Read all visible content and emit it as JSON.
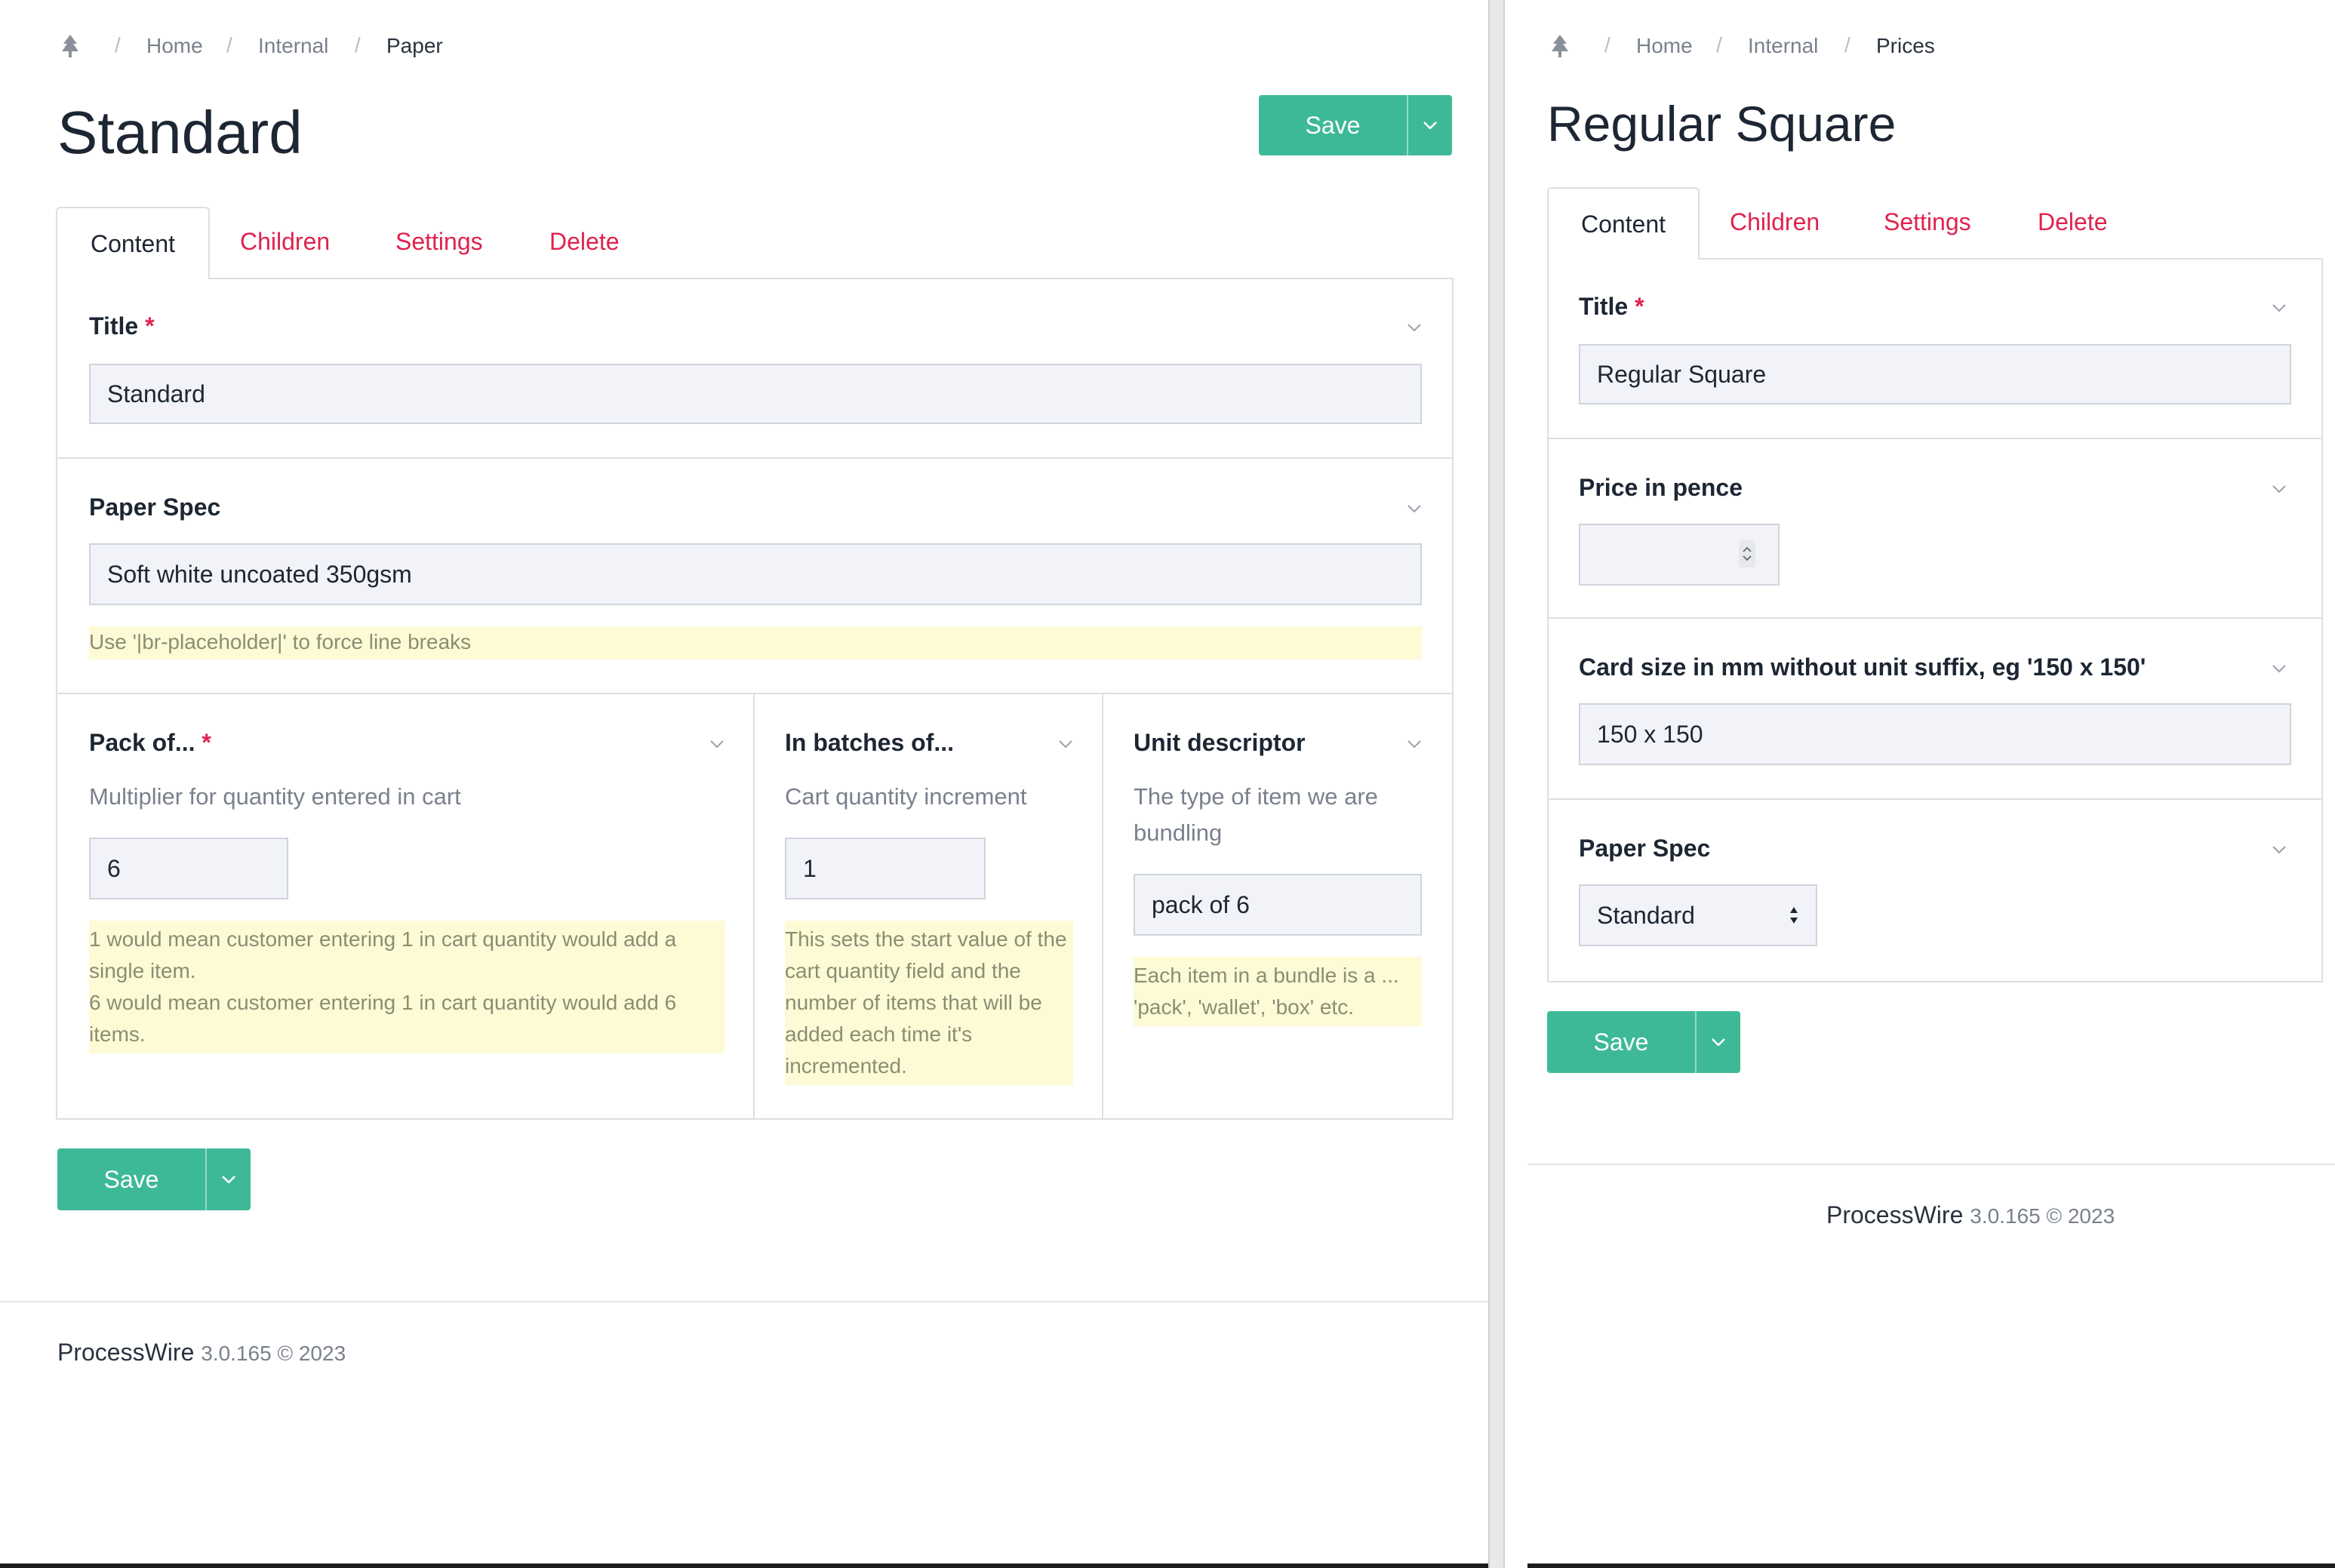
{
  "left": {
    "breadcrumb": [
      "Home",
      "Internal",
      "Paper"
    ],
    "title": "Standard",
    "save_label": "Save",
    "tabs": [
      "Content",
      "Children",
      "Settings",
      "Delete"
    ],
    "fields": {
      "title": {
        "label": "Title",
        "required_mark": "*",
        "value": "Standard"
      },
      "paper_spec": {
        "label": "Paper Spec",
        "value": "Soft white uncoated 350gsm",
        "note": "Use '|br-placeholder|' to force line breaks"
      },
      "pack_of": {
        "label": "Pack of...",
        "required_mark": "*",
        "description": "Multiplier for quantity entered in cart",
        "value": "6",
        "note": [
          "1 would mean customer entering 1 in cart quantity would add a single item.",
          "6 would mean customer entering 1 in cart quantity would add 6 items."
        ]
      },
      "in_batches_of": {
        "label": "In batches of...",
        "description": "Cart quantity increment",
        "value": "1",
        "note": "This sets the start value of the cart quantity field and the number of items that will be added each time it's incremented."
      },
      "unit_descriptor": {
        "label": "Unit descriptor",
        "description": "The type of item we are bundling",
        "value": "pack of 6",
        "note": "Each item in a bundle is a ... 'pack', 'wallet', 'box' etc."
      }
    },
    "footer": {
      "brand": "ProcessWire",
      "version": "3.0.165 © 2023"
    }
  },
  "right": {
    "breadcrumb": [
      "Home",
      "Internal",
      "Prices"
    ],
    "title": "Regular Square",
    "save_label": "Save",
    "tabs": [
      "Content",
      "Children",
      "Settings",
      "Delete"
    ],
    "fields": {
      "title": {
        "label": "Title",
        "required_mark": "*",
        "value": "Regular Square"
      },
      "price_in_pence": {
        "label": "Price in pence",
        "value": ""
      },
      "card_size": {
        "label": "Card size in mm without unit suffix, eg '150 x 150'",
        "value": "150 x 150"
      },
      "paper_spec": {
        "label": "Paper Spec",
        "selected": "Standard"
      }
    },
    "footer": {
      "brand": "ProcessWire",
      "version": "3.0.165 © 2023"
    }
  },
  "colors": {
    "accent": "#3eb998",
    "tab_link": "#e0224d",
    "note_bg": "#fdfbd6"
  },
  "icons": [
    "tree-icon",
    "chevron-down-icon",
    "spinner-icon",
    "select-arrows-icon"
  ]
}
